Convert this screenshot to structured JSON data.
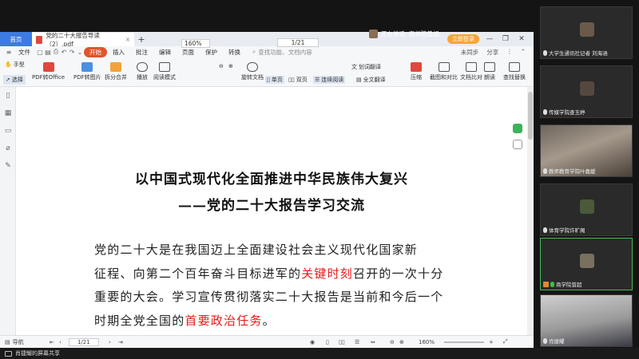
{
  "meeting": {
    "speaking_label": "正在讲话: 商学院曾超;"
  },
  "tabbar": {
    "home_tab": "首页",
    "doc_tab": "党的二十大报告导读（2）.pdf",
    "login_label": "立即登录"
  },
  "menubar": {
    "items": [
      "文件",
      "开始",
      "插入",
      "批注",
      "编辑",
      "页面",
      "保护",
      "转换"
    ],
    "active_item": "开始",
    "search_placeholder": "查找功能、文档内容",
    "right_items": [
      "未同步",
      "分享"
    ]
  },
  "toolbar": {
    "hand": "手型",
    "select": "选择",
    "pdf_to_office": "PDF转Office",
    "pdf_to_image": "PDF转图片",
    "split_merge": "拆分合并",
    "play": "播放",
    "reading_mode": "阅读模式",
    "zoom": "160%",
    "page_input": "1/21",
    "rotate": "旋转文档",
    "single_page": "单页",
    "double_page": "双页",
    "continuous": "连续阅读",
    "translate": "划词翻译",
    "full_translate": "全文翻译",
    "compress": "压缩",
    "screenshot": "截图和对比",
    "doc_compare": "文档比对",
    "read_aloud": "朗读",
    "find_replace": "查找替换"
  },
  "document": {
    "title_line1": "以中国式现代化全面推进中华民族伟大复兴",
    "title_line2": "——党的二十大报告学习交流",
    "para_line1": "党的二十大是在我国迈上全面建设社会主义现代化国家新",
    "para_line2_a": "征程、向第二个百年奋斗目标进军的",
    "para_line2_red": "关键时刻",
    "para_line2_b": "召开的一次十分",
    "para_line3": "重要的大会。学习宣传贯彻落实二十大报告是当前和今后一个",
    "para_line4_a": "时期全党全国的",
    "para_line4_red": "首要政治任务",
    "para_line4_b": "。"
  },
  "statusbar": {
    "outline": "导航",
    "page": "1/21",
    "zoom": "160%"
  },
  "sharebar": {
    "label": "肖捷耀的屏幕共享"
  },
  "participants": [
    {
      "name": "大学生通讯社记者 刘海涵",
      "speaking": false
    },
    {
      "name": "传媒学院查玉婷",
      "speaking": false
    },
    {
      "name": "教师教育学院叶嘉媛",
      "speaking": false
    },
    {
      "name": "体育学院许旷阁",
      "speaking": false
    },
    {
      "name": "商学院曾超",
      "speaking": true
    },
    {
      "name": "肖捷耀",
      "speaking": false
    }
  ],
  "colors": {
    "accent_blue": "#3d7be0",
    "active_menu": "#e0542c",
    "highlight_red": "#e41b1b",
    "speaking_green": "#37c24a"
  }
}
